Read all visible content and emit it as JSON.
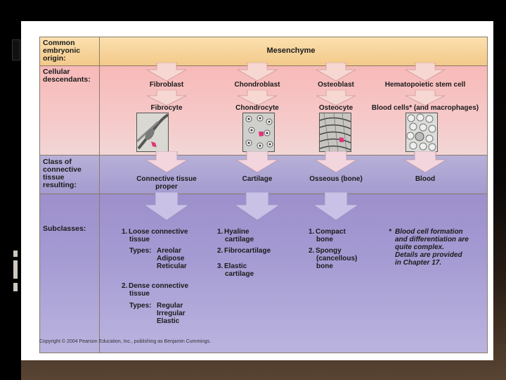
{
  "rows": {
    "origin": "Common\nembryonic\norigin:",
    "descendants": "Cellular\ndescendants:",
    "class": "Class of\nconnective\ntissue\nresulting:",
    "subclasses": "Subclasses:"
  },
  "origin_label": "Mesenchyme",
  "columns": [
    {
      "blast": "Fibroblast",
      "cyte": "Fibrocyte",
      "tissue": "Connective tissue\nproper"
    },
    {
      "blast": "Chondroblast",
      "cyte": "Chondrocyte",
      "tissue": "Cartilage"
    },
    {
      "blast": "Osteoblast",
      "cyte": "Osteocyte",
      "tissue": "Osseous (bone)"
    },
    {
      "blast": "Hematopoietic stem cell",
      "cyte": "Blood cells* (and macrophages)",
      "tissue": "Blood"
    }
  ],
  "subclasses": {
    "ct": {
      "i1n": "1.",
      "i1": "Loose connective",
      "i1b": "tissue",
      "types1": "Types:",
      "types1_list": [
        "Areolar",
        "Adipose",
        "Reticular"
      ],
      "i2n": "2.",
      "i2": "Dense connective",
      "i2b": "tissue",
      "types2": "Types:",
      "types2_list": [
        "Regular",
        "Irregular",
        "Elastic"
      ]
    },
    "cart": {
      "i1n": "1.",
      "i1": "Hyaline",
      "i1b": "cartilage",
      "i2n": "2.",
      "i2": "Fibrocartilage",
      "i3n": "3.",
      "i3": "Elastic",
      "i3b": "cartilage"
    },
    "bone": {
      "i1n": "1.",
      "i1": "Compact",
      "i1b": "bone",
      "i2n": "2.",
      "i2": "Spongy",
      "i2b": "(cancellous)",
      "i2c": "bone"
    },
    "blood_note_star": "*",
    "blood_note": "Blood cell formation\nand differentiation are\nquite complex.\nDetails are provided\nin Chapter 17."
  },
  "copyright": "Copyright © 2004 Pearson Education, Inc., publishing as Benjamin Cummings.",
  "colors": {
    "origin": "#f3c98a",
    "descendants": "#f7b9b8",
    "class": "#a49bcf",
    "arrow": "#f7d7d2",
    "marker": "#e0357a"
  }
}
